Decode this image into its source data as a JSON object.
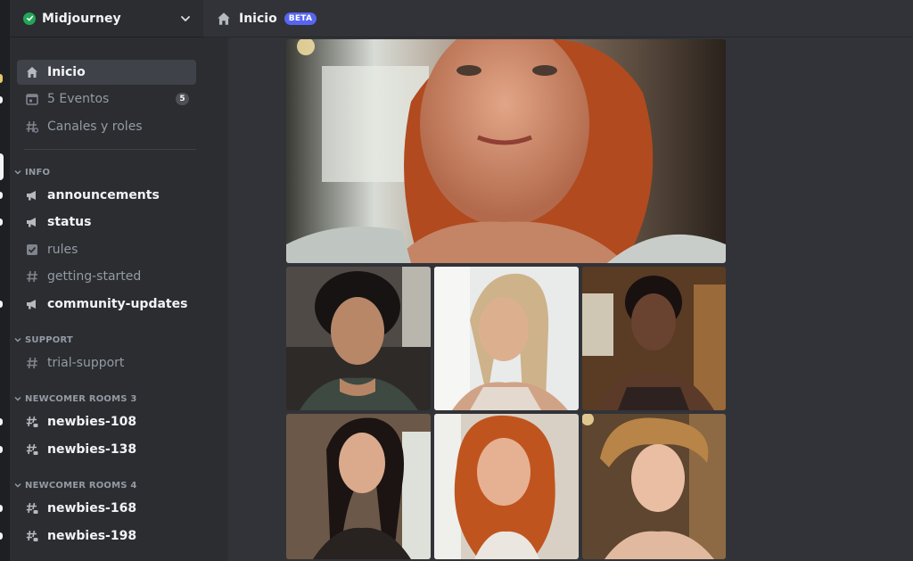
{
  "server": {
    "name": "Midjourney"
  },
  "topbar": {
    "title": "Inicio",
    "badge": "BETA"
  },
  "nav": {
    "home": "Inicio",
    "events": "5 Eventos",
    "events_count": "5",
    "channels_roles": "Canales y roles"
  },
  "categories": [
    {
      "name": "INFO",
      "channels": [
        {
          "name": "announcements",
          "icon": "megaphone-icon"
        },
        {
          "name": "status",
          "icon": "megaphone-icon"
        },
        {
          "name": "rules",
          "icon": "checkbox-icon"
        },
        {
          "name": "getting-started",
          "icon": "hashtag-icon"
        },
        {
          "name": "community-updates",
          "icon": "megaphone-icon"
        }
      ]
    },
    {
      "name": "SUPPORT",
      "channels": [
        {
          "name": "trial-support",
          "icon": "hashtag-icon"
        }
      ]
    },
    {
      "name": "NEWCOMER ROOMS 3",
      "channels": [
        {
          "name": "newbies-108",
          "icon": "hashtag-thread-icon"
        },
        {
          "name": "newbies-138",
          "icon": "hashtag-thread-icon"
        }
      ]
    },
    {
      "name": "NEWCOMER ROOMS 4",
      "channels": [
        {
          "name": "newbies-168",
          "icon": "hashtag-thread-icon"
        },
        {
          "name": "newbies-198",
          "icon": "hashtag-thread-icon"
        }
      ]
    }
  ],
  "colors": {
    "accent": "#5865f2",
    "online": "#23a559"
  }
}
